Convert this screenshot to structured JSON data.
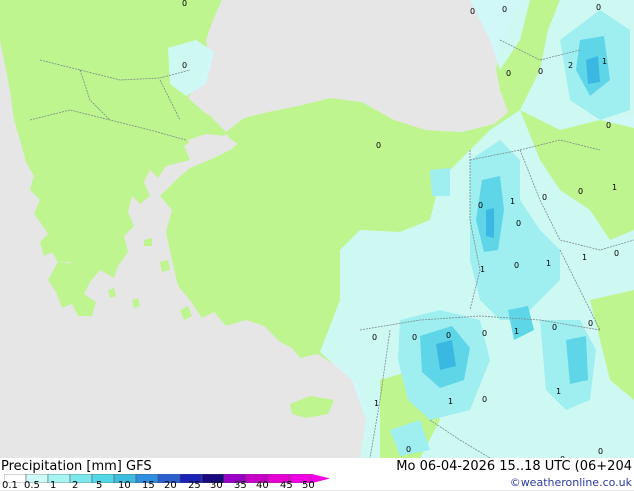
{
  "legend": {
    "title": "Precipitation [mm]  GFS",
    "datetime": "Mo 06-04-2026 15..18 UTC (06+204",
    "credit": "©weatheronline.co.uk",
    "ticks": [
      "0.1",
      "0.5",
      "1",
      "2",
      "5",
      "10",
      "15",
      "20",
      "25",
      "30",
      "35",
      "40",
      "45",
      "50"
    ],
    "colors": [
      "#ffffff",
      "#cffafa",
      "#a6f3f3",
      "#7de8ec",
      "#52d8e6",
      "#3cbcdf",
      "#2f8fe0",
      "#2b5fd0",
      "#1c24b8",
      "#1a0a80",
      "#9a00c8",
      "#c800c8",
      "#e600d6",
      "#f200e4"
    ]
  },
  "map_colors": {
    "sea": "#e6e6e6",
    "land": "#bff58f",
    "precip_light": "#cff9f9",
    "precip_moderate": "#9feef0",
    "precip_heavy": "#5fd6e8",
    "precip_very_heavy": "#3ab8e2",
    "border": "#7a8a8a"
  },
  "point_values": [
    "0",
    "0",
    "0",
    "0",
    "2",
    "1",
    "0",
    "0",
    "0",
    "0",
    "0",
    "1",
    "0",
    "0",
    "1",
    "0",
    "1",
    "1",
    "0",
    "1",
    "0",
    "0",
    "0",
    "1",
    "0",
    "1",
    "0",
    "0",
    "1",
    "0",
    "1",
    "0",
    "0",
    "0",
    "0",
    "0"
  ]
}
